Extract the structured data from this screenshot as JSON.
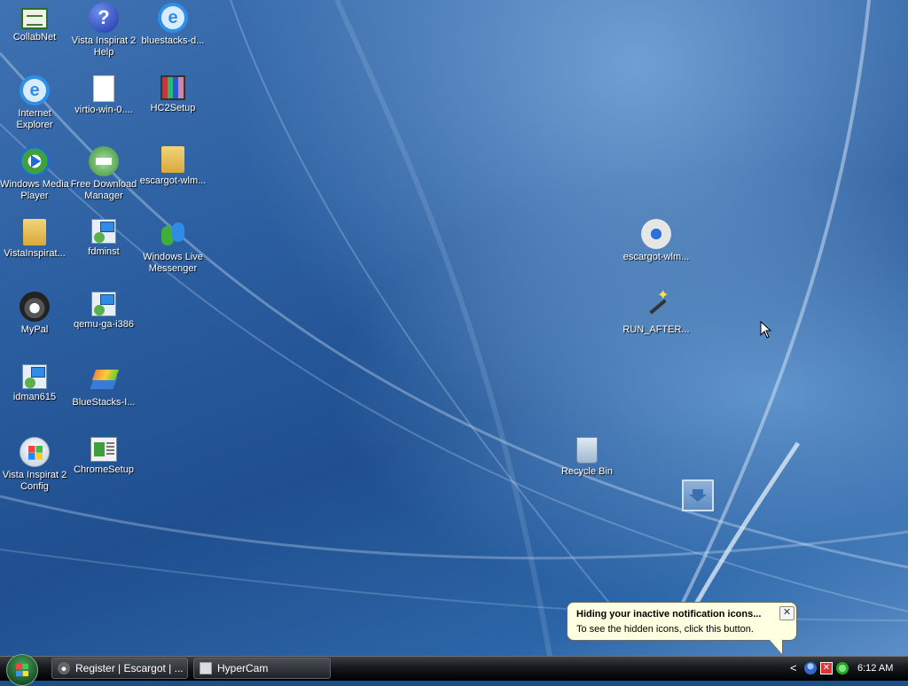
{
  "desktop": {
    "icons": [
      {
        "label": "CollabNet"
      },
      {
        "label": "Vista Inspirat 2 Help"
      },
      {
        "label": "bluestacks-d..."
      },
      {
        "label": "Internet Explorer"
      },
      {
        "label": "virtio-win-0...."
      },
      {
        "label": "HC2Setup"
      },
      {
        "label": "Windows Media Player"
      },
      {
        "label": "Free Download Manager"
      },
      {
        "label": "escargot-wlm..."
      },
      {
        "label": "VistaInspirat..."
      },
      {
        "label": "fdminst"
      },
      {
        "label": "Windows Live Messenger"
      },
      {
        "label": "MyPal"
      },
      {
        "label": "qemu-ga-i386"
      },
      {
        "label": "idman615"
      },
      {
        "label": "BlueStacks-I..."
      },
      {
        "label": "Vista Inspirat 2 Config"
      },
      {
        "label": "ChromeSetup"
      },
      {
        "label": "escargot-wlm..."
      },
      {
        "label": "RUN_AFTER..."
      },
      {
        "label": "Recycle Bin"
      }
    ]
  },
  "balloon": {
    "title": "Hiding your inactive notification icons...",
    "text": "To see the hidden icons, click this button.",
    "close_glyph": "✕"
  },
  "taskbar": {
    "buttons": [
      {
        "label": "Register | Escargot | ..."
      },
      {
        "label": "HyperCam"
      }
    ],
    "tray": {
      "chevron": "<",
      "clock": "6:12 AM"
    }
  },
  "icon_names": [
    "collabnet-icon",
    "help-icon",
    "page-icon",
    "internet-explorer-icon",
    "page-icon",
    "winrar-icon",
    "media-player-icon",
    "download-manager-icon",
    "zip-folder-icon",
    "folder-icon",
    "installer-icon",
    "messenger-icon",
    "raccoon-icon",
    "installer-icon",
    "installer-icon",
    "bluestacks-icon",
    "vista-icon",
    "chrome-setup-icon",
    "disc-installer-icon",
    "magic-wand-icon",
    "recycle-bin-icon"
  ]
}
